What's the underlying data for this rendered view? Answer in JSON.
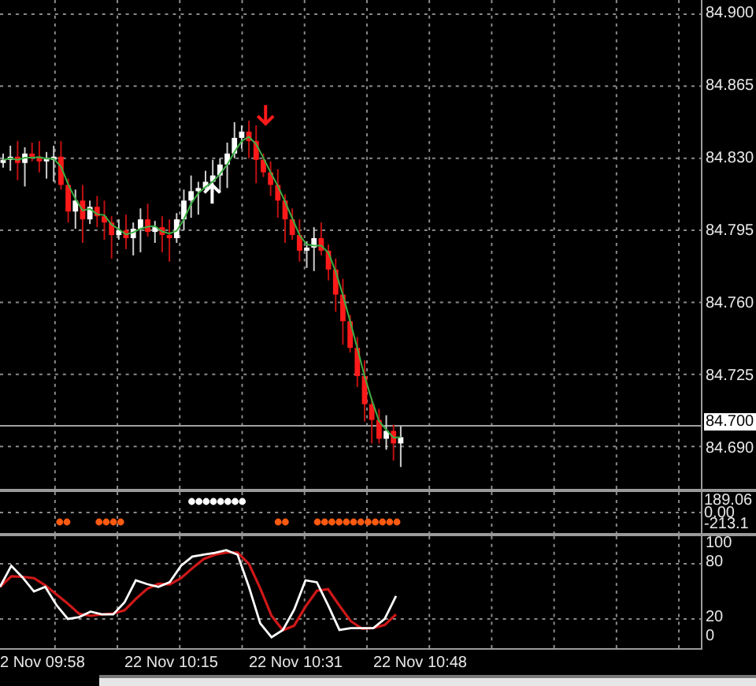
{
  "price_axis": {
    "labels": [
      "84.900",
      "84.865",
      "84.830",
      "84.795",
      "84.760",
      "84.725",
      "84.690"
    ],
    "current_price": "84.700"
  },
  "signal_panel": {
    "labels": [
      "189.06",
      "0.00",
      "-213.1"
    ]
  },
  "oscillator_panel": {
    "labels": [
      "100",
      "80",
      "20",
      "0"
    ]
  },
  "time_axis": {
    "labels": [
      "2 Nov 09:58",
      "22 Nov 10:15",
      "22 Nov 10:31",
      "22 Nov 10:48"
    ]
  }
}
